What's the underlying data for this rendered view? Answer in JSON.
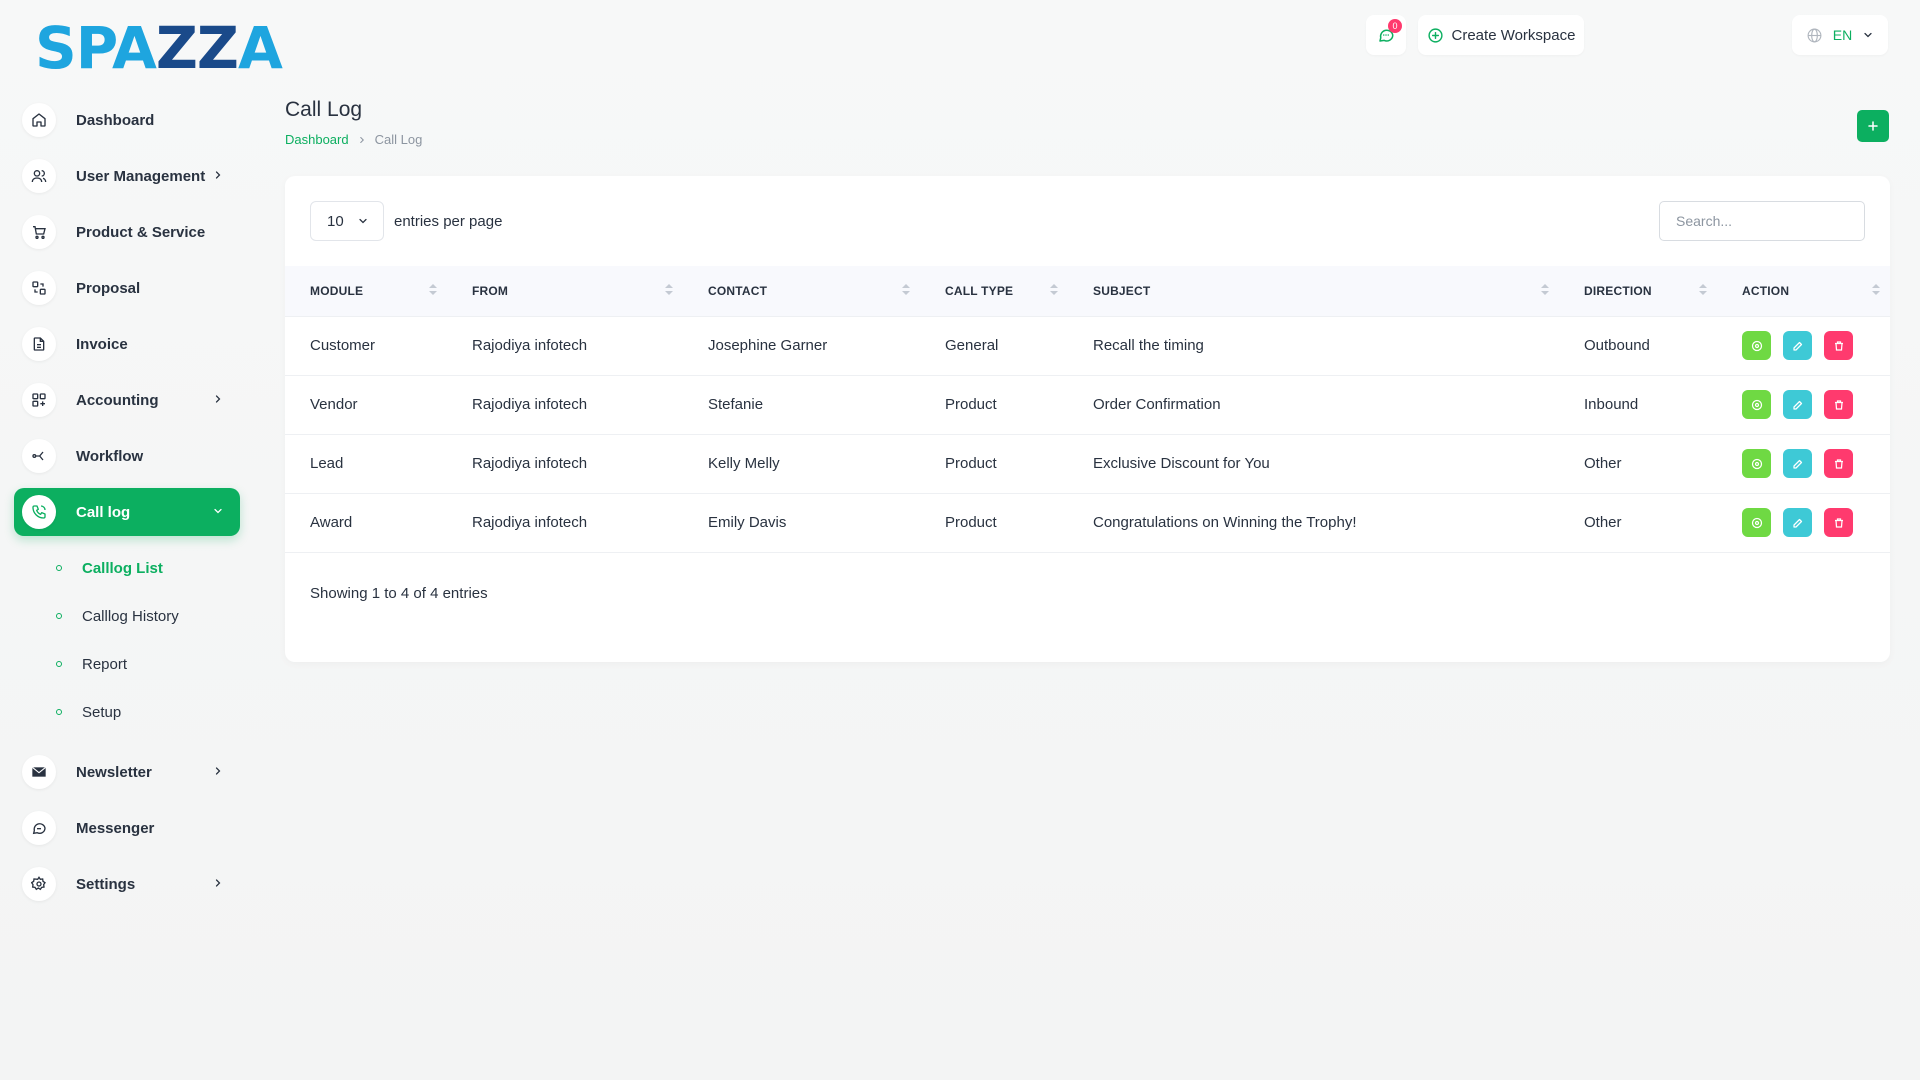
{
  "brand": {
    "logo_left": "SPA",
    "logo_mid": "ZZ",
    "logo_right": "A"
  },
  "topbar": {
    "messages_badge": "0",
    "create_workspace": "Create Workspace",
    "language": "EN"
  },
  "sidebar": {
    "items": [
      {
        "label": "Dashboard"
      },
      {
        "label": "User Management"
      },
      {
        "label": "Product & Service"
      },
      {
        "label": "Proposal"
      },
      {
        "label": "Invoice"
      },
      {
        "label": "Accounting"
      },
      {
        "label": "Workflow"
      },
      {
        "label": "Call log"
      },
      {
        "label": "Newsletter"
      },
      {
        "label": "Messenger"
      },
      {
        "label": "Settings"
      }
    ],
    "calllog_sub": [
      {
        "label": "Calllog List"
      },
      {
        "label": "Calllog History"
      },
      {
        "label": "Report"
      },
      {
        "label": "Setup"
      }
    ]
  },
  "page": {
    "title": "Call Log",
    "breadcrumb": {
      "home": "Dashboard",
      "current": "Call Log"
    }
  },
  "table_controls": {
    "per_page": "10",
    "entries_label": "entries per page",
    "search_placeholder": "Search...",
    "showing": "Showing 1 to 4 of 4 entries"
  },
  "table": {
    "headers": [
      "MODULE",
      "FROM",
      "CONTACT",
      "CALL TYPE",
      "SUBJECT",
      "DIRECTION",
      "ACTION"
    ],
    "rows": [
      {
        "module": "Customer",
        "from": "Rajodiya infotech",
        "contact": "Josephine Garner",
        "call_type": "General",
        "subject": "Recall the timing",
        "direction": "Outbound"
      },
      {
        "module": "Vendor",
        "from": "Rajodiya infotech",
        "contact": "Stefanie",
        "call_type": "Product",
        "subject": "Order Confirmation",
        "direction": "Inbound"
      },
      {
        "module": "Lead",
        "from": "Rajodiya infotech",
        "contact": "Kelly Melly",
        "call_type": "Product",
        "subject": "Exclusive Discount for You",
        "direction": "Other"
      },
      {
        "module": "Award",
        "from": "Rajodiya infotech",
        "contact": "Emily Davis",
        "call_type": "Product",
        "subject": "Congratulations on Winning the Trophy!",
        "direction": "Other"
      }
    ]
  },
  "colors": {
    "primary": "#0caf60",
    "view": "#6fd943",
    "edit": "#3ec9d6",
    "delete": "#ff3a6e",
    "logo": "#1ea5df"
  }
}
